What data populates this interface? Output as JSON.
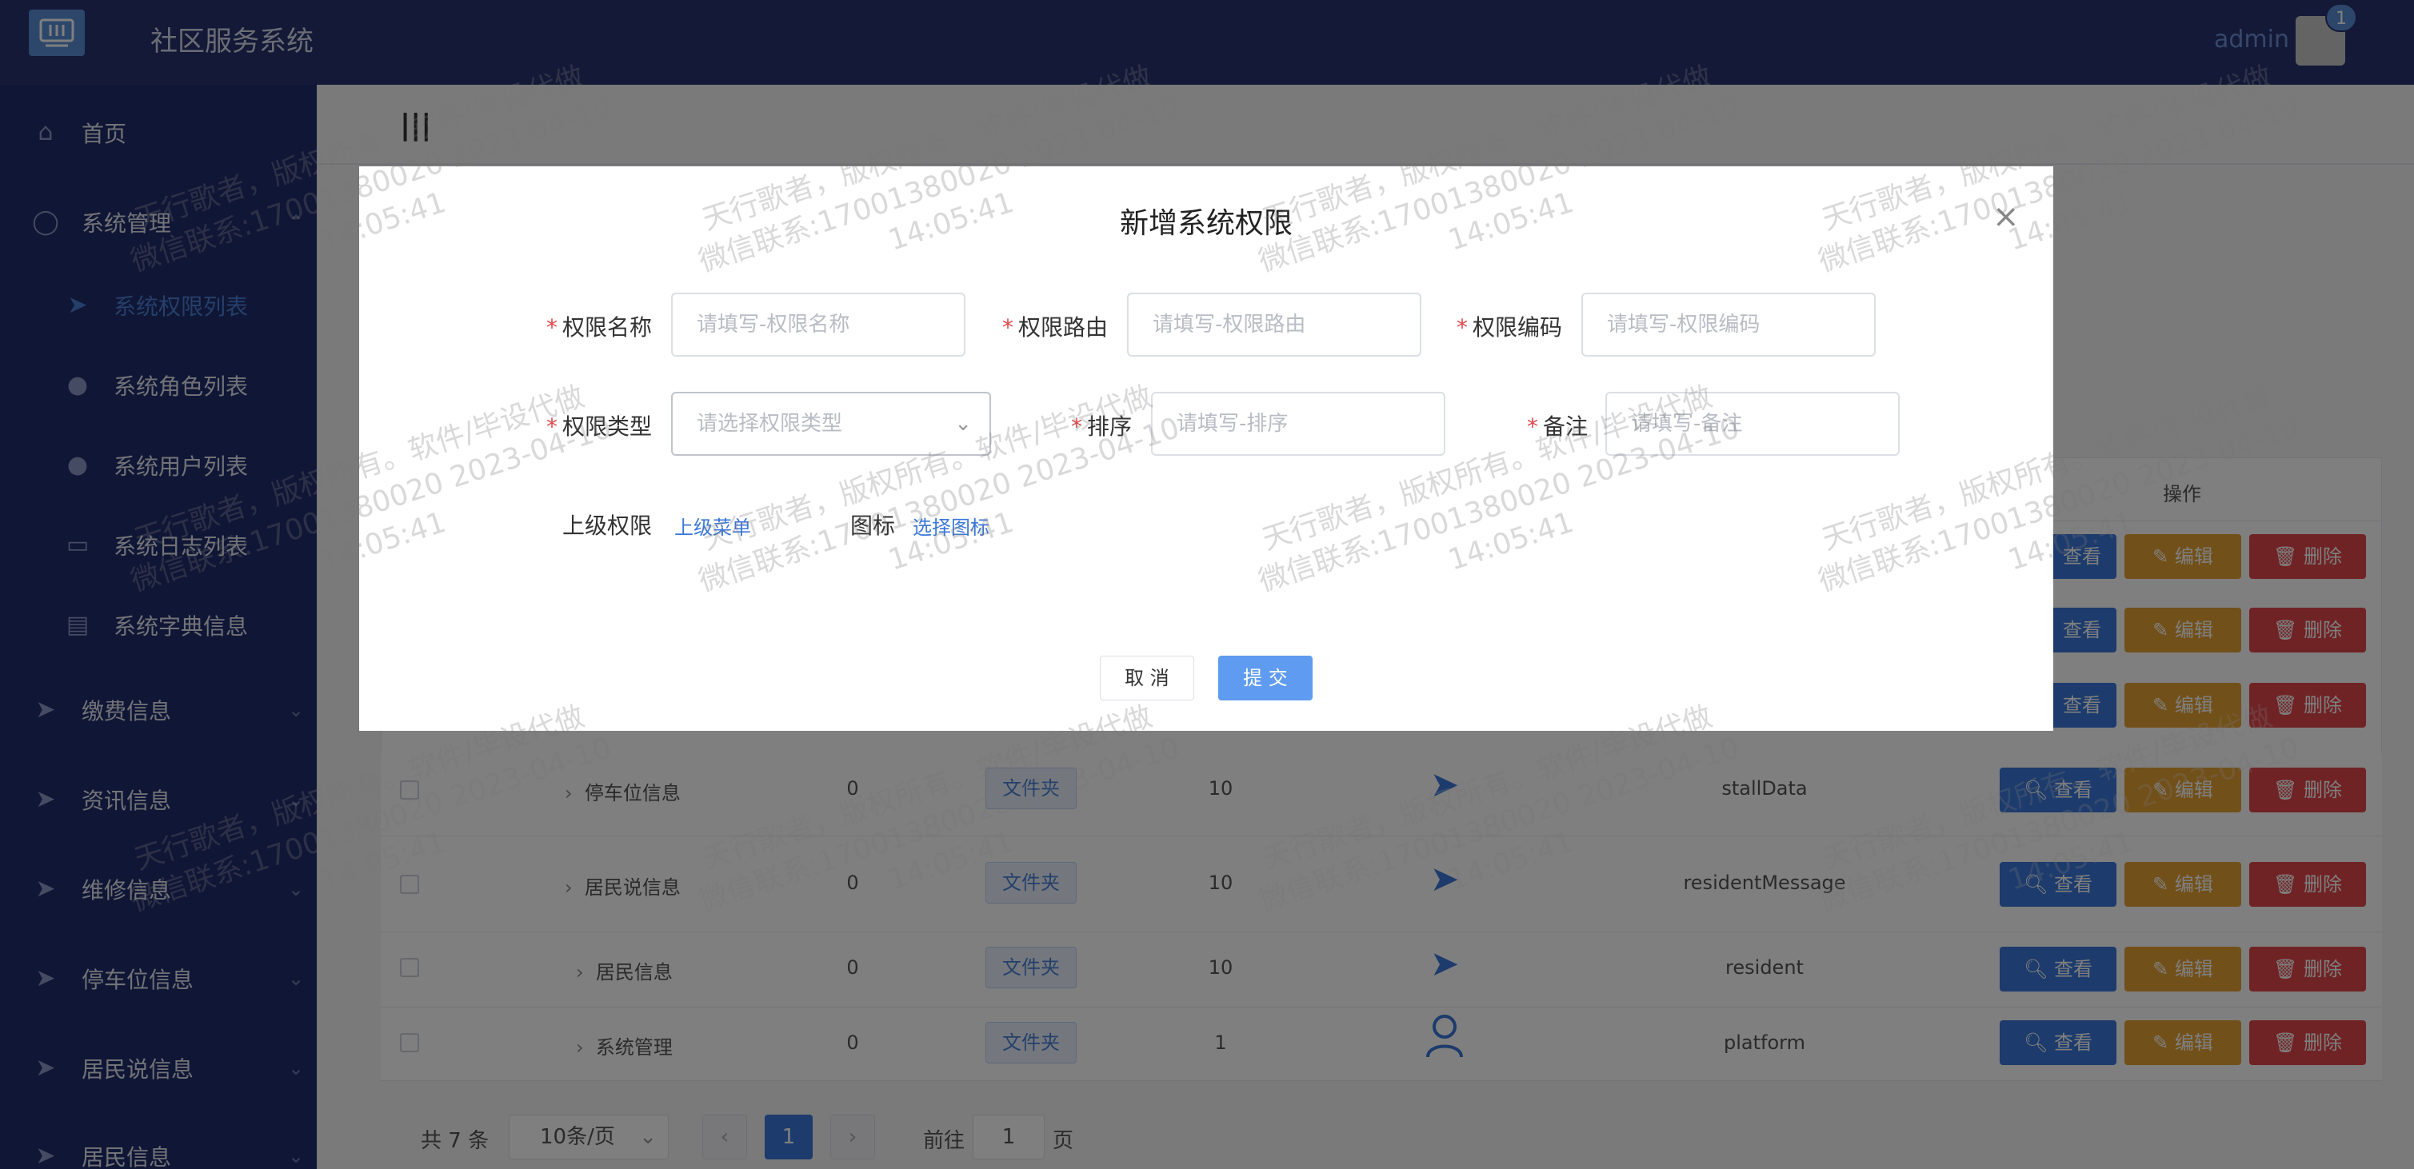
{
  "header": {
    "app_title": "社区服务系统",
    "admin_name": "admin",
    "badge_count": "1"
  },
  "sidebar": {
    "items": [
      {
        "label": "首页",
        "icon": "home-icon"
      },
      {
        "label": "系统管理",
        "icon": "user-icon"
      },
      {
        "label": "系统权限列表",
        "icon": "send-icon",
        "active": true
      },
      {
        "label": "系统角色列表",
        "icon": "person-icon"
      },
      {
        "label": "系统用户列表",
        "icon": "person-icon"
      },
      {
        "label": "系统日志列表",
        "icon": "message-icon"
      },
      {
        "label": "系统字典信息",
        "icon": "card-icon"
      },
      {
        "label": "缴费信息",
        "icon": "send-icon"
      },
      {
        "label": "资讯信息",
        "icon": "send-icon"
      },
      {
        "label": "维修信息",
        "icon": "send-icon"
      },
      {
        "label": "停车位信息",
        "icon": "send-icon"
      },
      {
        "label": "居民说信息",
        "icon": "send-icon"
      },
      {
        "label": "居民信息",
        "icon": "send-icon"
      }
    ]
  },
  "table": {
    "op_header": "操作",
    "view_label": "查看",
    "edit_label": "编辑",
    "delete_label": "删除",
    "rows": [
      {
        "name": "停车位信息",
        "parent": "0",
        "type": "文件夹",
        "sort": "10",
        "icon": "send-icon",
        "code": "stallData"
      },
      {
        "name": "居民说信息",
        "parent": "0",
        "type": "文件夹",
        "sort": "10",
        "icon": "send-icon",
        "code": "residentMessage"
      },
      {
        "name": "居民信息",
        "parent": "0",
        "type": "文件夹",
        "sort": "10",
        "icon": "send-icon",
        "code": "resident"
      },
      {
        "name": "系统管理",
        "parent": "0",
        "type": "文件夹",
        "sort": "1",
        "icon": "user-icon",
        "code": "platform"
      }
    ]
  },
  "pagination": {
    "total": "共 7 条",
    "page_size": "10条/页",
    "current": "1",
    "goto_label": "前往",
    "goto_value": "1",
    "page_suffix": "页"
  },
  "modal": {
    "title": "新增系统权限",
    "fields": {
      "name_label": "权限名称",
      "name_placeholder": "请填写-权限名称",
      "route_label": "权限路由",
      "route_placeholder": "请填写-权限路由",
      "code_label": "权限编码",
      "code_placeholder": "请填写-权限编码",
      "type_label": "权限类型",
      "type_placeholder": "请选择权限类型",
      "sort_label": "排序",
      "sort_placeholder": "请填写-排序",
      "remark_label": "备注",
      "remark_placeholder": "请填写-备注",
      "parent_label": "上级权限",
      "parent_link": "上级菜单",
      "icon_label": "图标",
      "icon_link": "选择图标"
    },
    "cancel_label": "取 消",
    "submit_label": "提 交"
  },
  "watermark": {
    "line1": "天行歌者，版权所有。软件/毕设代做",
    "line2": "微信联系:17001380020 2023-04-10",
    "line3": "14:05:41"
  },
  "colors": {
    "header_bg": "#27326f",
    "sidebar_bg": "#202d6b",
    "primary": "#3b77d8",
    "warning": "#e5a032",
    "danger": "#e1474a"
  }
}
